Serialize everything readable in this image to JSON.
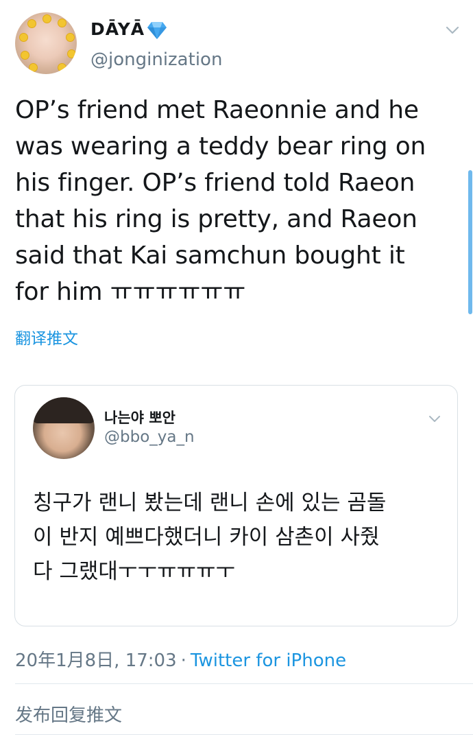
{
  "author": {
    "display_name": "DĀYĀ",
    "handle": "@jonginization",
    "verified_badge_icon": "diamond-icon",
    "badge_color": "#45a8f0"
  },
  "tweet": {
    "text": "OP’s friend met Raeonnie and he\nwas wearing a teddy bear ring on\nhis finger. OP’s friend told Raeon\nthat his ring is pretty, and Raeon\nsaid that Kai samchun bought it\nfor him ㅠㅠㅠㅠㅠㅠ",
    "translate_label": "翻译推文"
  },
  "quoted_tweet": {
    "display_name": "나는야 뽀안",
    "handle": "@bbo_ya_n",
    "text": "칭구가 랜니 봤는데 랜니 손에 있는 곰돌\n이 반지 예쁘다했더니 카이 삼촌이 사줬\n다 그랬대ㅜㅜㅠㅠㅠㅜ"
  },
  "meta": {
    "timestamp": "20年1月8日, 17:03",
    "separator": "·",
    "source": "Twitter for iPhone"
  },
  "reply": {
    "prompt": "发布回复推文"
  },
  "colors": {
    "link": "#1b95e0",
    "secondary_text": "#657786",
    "border": "#d8dfe4",
    "scrollbar": "#6fb9ed"
  }
}
